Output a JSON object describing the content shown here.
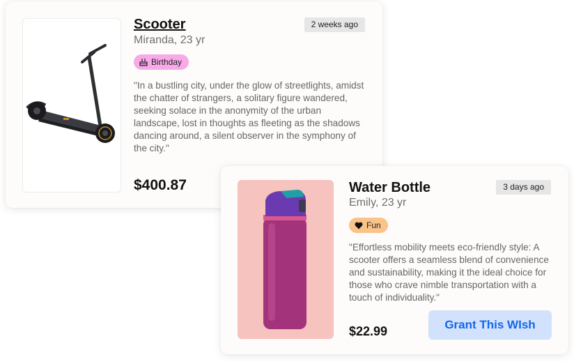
{
  "wishes": [
    {
      "title": "Scooter",
      "recipient": "Miranda, 23 yr",
      "posted": "2 weeks ago",
      "tag": {
        "label": "Birthday",
        "icon": "cake-icon",
        "color": "#f7a9e8"
      },
      "quote": "\"In a bustling city, under the glow of streetlights, amidst the chatter of strangers, a solitary figure wandered, seeking solace in the anonymity of the urban landscape, lost in thoughts as fleeting as the shadows dancing around, a silent observer in the symphony of the city.\"",
      "price": "$400.87",
      "image": "electric-scooter"
    },
    {
      "title": "Water Bottle",
      "recipient": "Emily, 23 yr",
      "posted": "3 days ago",
      "tag": {
        "label": "Fun",
        "icon": "heart-icon",
        "color": "#f9c38a"
      },
      "quote": "\"Effortless mobility meets eco-friendly style: A scooter offers a seamless blend of convenience and sustainability, making it the ideal choice for those who crave nimble transportation with a touch of individuality.\"",
      "price": "$22.99",
      "image": "purple-water-bottle",
      "action_label": "Grant This WIsh"
    }
  ],
  "colors": {
    "accent_button_bg": "#d3e2fc",
    "accent_button_text": "#1466ea",
    "image_bg_bottle": "#f6c3bf"
  }
}
